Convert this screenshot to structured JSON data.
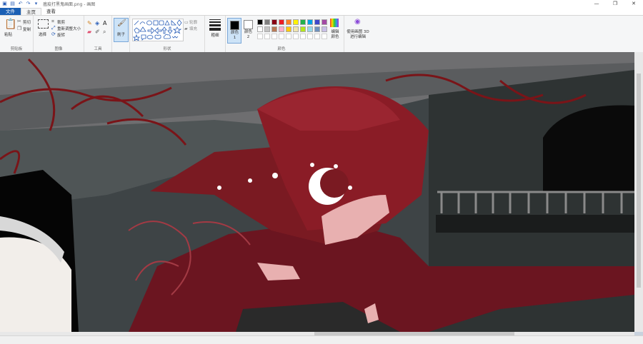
{
  "window": {
    "title": "瘟疫打黑鬼画面.png - 画图",
    "controls": [
      "—",
      "❐",
      "✕"
    ]
  },
  "tabs": [
    {
      "label": "文件"
    },
    {
      "label": "主页"
    },
    {
      "label": "查看"
    }
  ],
  "ribbon": {
    "clipboard": {
      "paste": "粘贴",
      "cut": "剪切",
      "copy": "复制",
      "label": "剪贴板"
    },
    "image": {
      "select": "选择",
      "crop": "裁剪",
      "resize": "重新调整大小",
      "rotate": "旋转",
      "label": "图像"
    },
    "tools": {
      "label": "工具"
    },
    "brushes": {
      "label": "刷子"
    },
    "shapes": {
      "outline": "轮廓",
      "fill": "填充",
      "label": "形状"
    },
    "size": {
      "label": "粗细"
    },
    "color1": {
      "label": "颜色 1"
    },
    "color2": {
      "label": "颜色 2"
    },
    "colors": {
      "edit": "编辑颜色",
      "label": "颜色"
    },
    "paint3d": {
      "label": "使用画图 3D 进行编辑"
    }
  },
  "palette": [
    "#000000",
    "#7f7f7f",
    "#880015",
    "#ed1c24",
    "#ff7f27",
    "#fff200",
    "#22b14c",
    "#00a2e8",
    "#3f48cc",
    "#a349a4",
    "#ffffff",
    "#c3c3c3",
    "#b97a57",
    "#ffaec9",
    "#ffc90e",
    "#efe4b0",
    "#b5e61d",
    "#99d9ea",
    "#7092be",
    "#c8bfe7"
  ],
  "colors_selected": {
    "color1": "#000000",
    "color2": "#ffffff"
  }
}
